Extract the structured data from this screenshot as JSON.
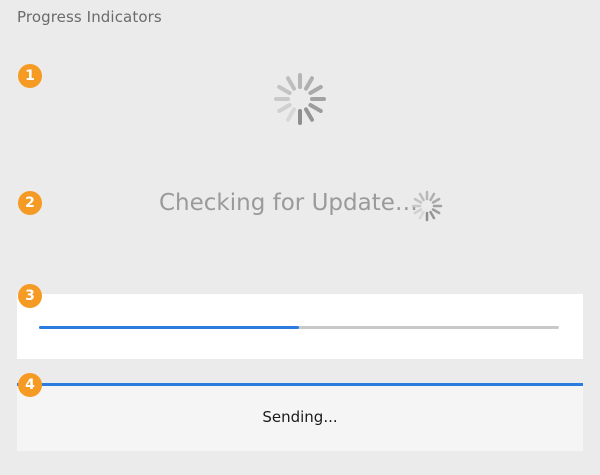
{
  "header": {
    "title": "Progress Indicators"
  },
  "badges": [
    "1",
    "2",
    "3",
    "4"
  ],
  "indicator_1": {
    "type": "indeterminate-spinner",
    "icon": "spinner-icon"
  },
  "indicator_2": {
    "status_text": "Checking for Update…",
    "icon": "spinner-icon"
  },
  "indicator_3": {
    "type": "determinate-progress-bar",
    "progress": 0.5
  },
  "indicator_4": {
    "type": "progress-bar-with-label",
    "progress": 1.0,
    "status_text": "Sending..."
  },
  "colors": {
    "background": "#ebebeb",
    "badge": "#f59a23",
    "accent": "#2c7ce0",
    "track": "#c9c9c9",
    "spinner": "#8a8a8a"
  }
}
